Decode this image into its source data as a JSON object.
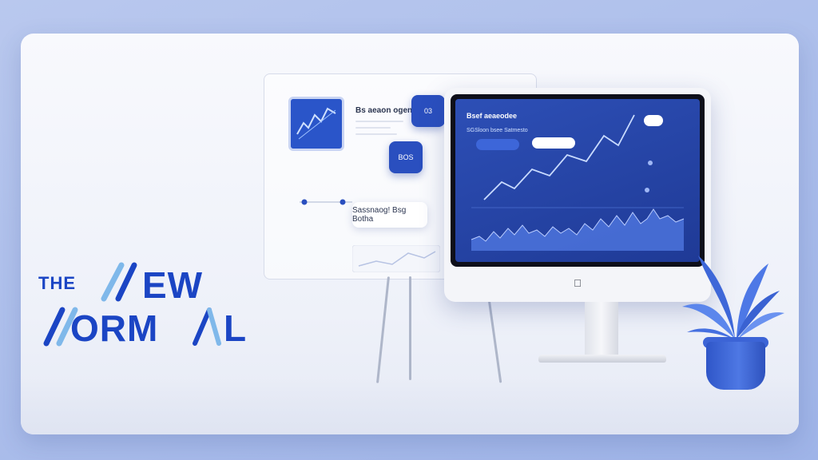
{
  "colors": {
    "background_outer": "#b9c8ee",
    "accent_blue": "#1b45c4",
    "accent_light_blue": "#7fb8ea",
    "screen_blue": "#2a4fbf"
  },
  "title": {
    "word_the": "THE",
    "word_new_suffix": "EW",
    "word_normal_mid": "ORM",
    "word_normal_end": "L"
  },
  "board": {
    "heading": "Bs aeaon ogen",
    "tile1": "03",
    "tile2": "BOS",
    "bubble": "Sassnaog! Bsg Botha"
  },
  "monitor": {
    "title": "Bsef aeaeodee",
    "subtitle": "SGSloon bsee Satmesto"
  },
  "icons": [
    "apple-logo-icon",
    "plant-decoration"
  ]
}
